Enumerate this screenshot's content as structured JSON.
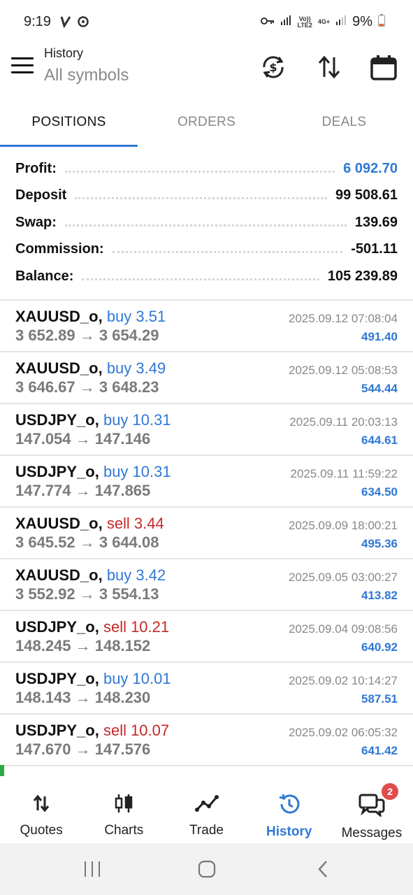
{
  "status_bar": {
    "time": "9:19",
    "battery_text": "9%",
    "net_volte": "Vo))",
    "net_lte": "LTE2",
    "net_4g": "4G+"
  },
  "header": {
    "title": "History",
    "subtitle": "All symbols"
  },
  "tabs": [
    {
      "label": "POSITIONS",
      "active": true
    },
    {
      "label": "ORDERS",
      "active": false
    },
    {
      "label": "DEALS",
      "active": false
    }
  ],
  "summary": {
    "profit": {
      "label": "Profit:",
      "value": "6 092.70"
    },
    "deposit": {
      "label": "Deposit",
      "value": "99 508.61"
    },
    "swap": {
      "label": "Swap:",
      "value": "139.69"
    },
    "commission": {
      "label": "Commission:",
      "value": "-501.11"
    },
    "balance": {
      "label": "Balance:",
      "value": "105 239.89"
    }
  },
  "deals": [
    {
      "symbol": "XAUUSD_o,",
      "side": "buy 3.51",
      "type": "buy",
      "prices": "3 652.89 → 3 654.29",
      "time": "2025.09.12 07:08:04",
      "profit": "491.40"
    },
    {
      "symbol": "XAUUSD_o,",
      "side": "buy 3.49",
      "type": "buy",
      "prices": "3 646.67 → 3 648.23",
      "time": "2025.09.12 05:08:53",
      "profit": "544.44"
    },
    {
      "symbol": "USDJPY_o,",
      "side": "buy 10.31",
      "type": "buy",
      "prices": "147.054 → 147.146",
      "time": "2025.09.11 20:03:13",
      "profit": "644.61"
    },
    {
      "symbol": "USDJPY_o,",
      "side": "buy 10.31",
      "type": "buy",
      "prices": "147.774 → 147.865",
      "time": "2025.09.11 11:59:22",
      "profit": "634.50"
    },
    {
      "symbol": "XAUUSD_o,",
      "side": "sell 3.44",
      "type": "sell",
      "prices": "3 645.52 → 3 644.08",
      "time": "2025.09.09 18:00:21",
      "profit": "495.36"
    },
    {
      "symbol": "XAUUSD_o,",
      "side": "buy 3.42",
      "type": "buy",
      "prices": "3 552.92 → 3 554.13",
      "time": "2025.09.05 03:00:27",
      "profit": "413.82"
    },
    {
      "symbol": "USDJPY_o,",
      "side": "sell 10.21",
      "type": "sell",
      "prices": "148.245 → 148.152",
      "time": "2025.09.04 09:08:56",
      "profit": "640.92"
    },
    {
      "symbol": "USDJPY_o,",
      "side": "buy 10.01",
      "type": "buy",
      "prices": "148.143 → 148.230",
      "time": "2025.09.02 10:14:27",
      "profit": "587.51"
    },
    {
      "symbol": "USDJPY_o,",
      "side": "sell 10.07",
      "type": "sell",
      "prices": "147.670 → 147.576",
      "time": "2025.09.02 06:05:32",
      "profit": "641.42"
    }
  ],
  "bottom_nav": {
    "quotes": "Quotes",
    "charts": "Charts",
    "trade": "Trade",
    "history": "History",
    "messages": "Messages",
    "messages_badge": "2"
  },
  "colors": {
    "accent": "#2f78d6",
    "sell": "#c62828",
    "badge": "#e04b4b"
  }
}
